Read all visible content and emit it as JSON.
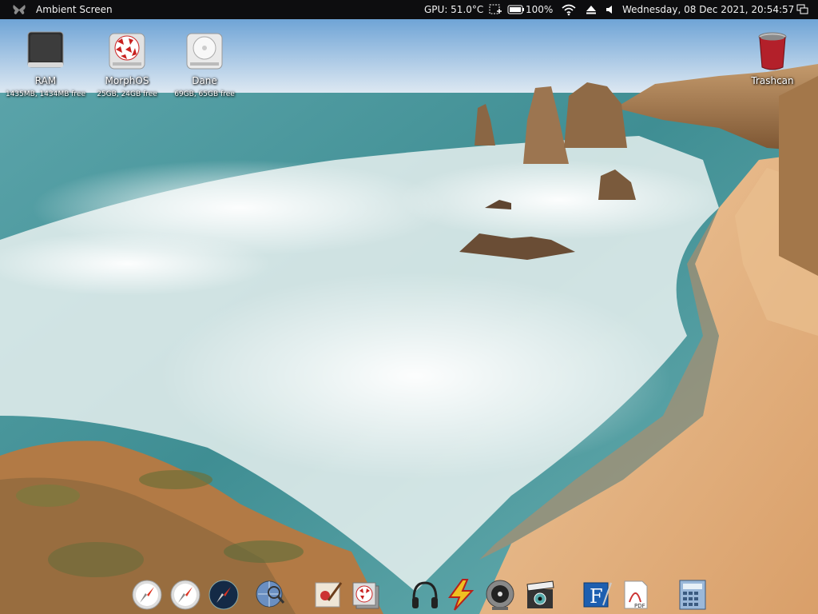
{
  "topbar": {
    "app_title": "Ambient Screen",
    "menu_icon": "butterfly-icon",
    "gpu": "GPU: 51.0°C",
    "battery": "100%",
    "datetime": "Wednesday, 08 Dec 2021, 20:54:57",
    "status_icons": [
      "screenbar-icon",
      "battery-icon",
      "wifi-icon",
      "eject-icon",
      "volume-icon",
      "window-switch-icon"
    ]
  },
  "desktop": {
    "icons": [
      {
        "label": "RAM",
        "info": "1435MB, 1434MB free",
        "icon": "ram-disk-icon"
      },
      {
        "label": "MorphOS",
        "info": "25GB, 24GB free",
        "icon": "morphos-drive-icon"
      },
      {
        "label": "Dane",
        "info": "69GB, 65GB free",
        "icon": "hard-drive-icon"
      },
      {
        "label": "Trashcan",
        "icon": "trashcan-icon"
      }
    ]
  },
  "dock": {
    "items": [
      "safari-compass-icon",
      "safari-compass-icon",
      "compass-dark-icon",
      "globe-search-icon",
      "paint-icon",
      "boing-ball-stack-icon",
      "headphones-icon",
      "lightning-icon",
      "disc-player-icon",
      "clapperboard-icon",
      "font-editor-icon",
      "pdf-viewer-icon",
      "calculator-icon"
    ]
  },
  "colors": {
    "topbar_bg": "#0d0d0f",
    "sea": "#4f9aa0",
    "sand": "#e2b07c",
    "sky": "#bcd6ec"
  }
}
